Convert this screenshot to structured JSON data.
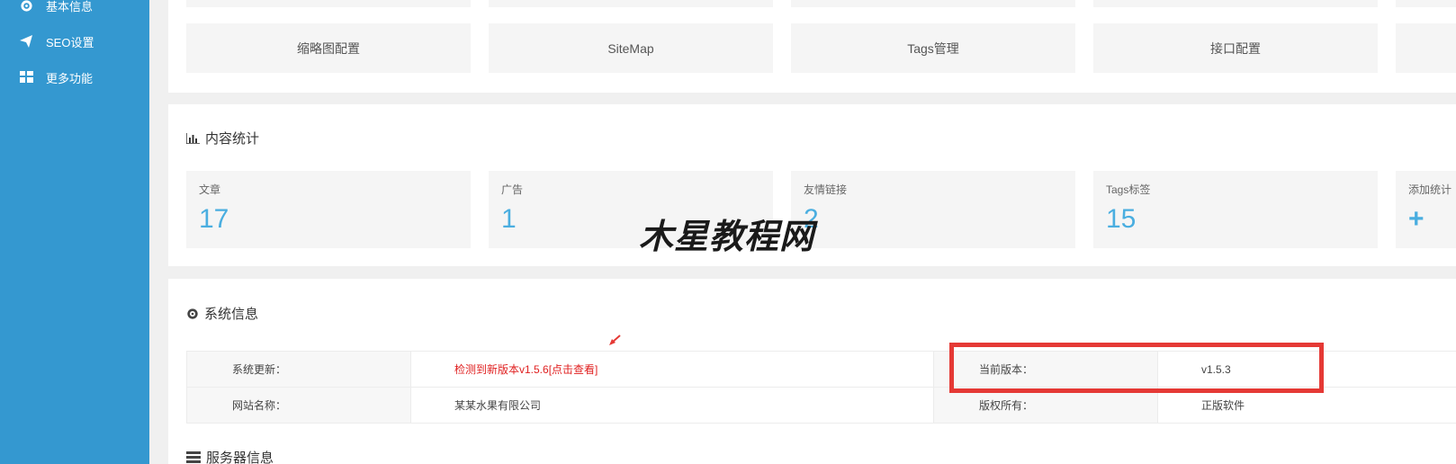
{
  "sidebar": {
    "items": [
      {
        "label": "基本信息",
        "icon": "gear-icon"
      },
      {
        "label": "SEO设置",
        "icon": "paper-plane-icon"
      },
      {
        "label": "更多功能",
        "icon": "grid-icon"
      }
    ]
  },
  "quick_buttons": [
    "缩略图配置",
    "SiteMap",
    "Tags管理",
    "接口配置"
  ],
  "stats": {
    "title": "内容统计",
    "items": [
      {
        "label": "文章",
        "value": "17"
      },
      {
        "label": "广告",
        "value": "1"
      },
      {
        "label": "友情链接",
        "value": "2"
      },
      {
        "label": "Tags标签",
        "value": "15"
      },
      {
        "label": "添加统计",
        "value": "+"
      }
    ]
  },
  "system": {
    "title": "系统信息",
    "rows": [
      {
        "k1": "系统更新：",
        "v1": "检测到新版本v1.5.6[点击查看]",
        "k2": "当前版本：",
        "v2": "v1.5.3"
      },
      {
        "k1": "网站名称：",
        "v1": "某某水果有限公司",
        "k2": "版权所有：",
        "v2": "正版软件"
      }
    ]
  },
  "server": {
    "title": "服务器信息"
  },
  "watermark": "木星教程网",
  "colors": {
    "sidebar": "#3498d0",
    "accent": "#4aaee0",
    "highlight": "#e53935",
    "update_link": "#e02020"
  }
}
